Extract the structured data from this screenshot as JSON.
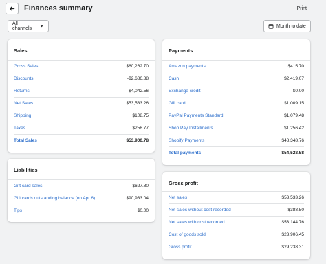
{
  "header": {
    "title": "Finances summary",
    "print_label": "Print"
  },
  "filters": {
    "channels_label": "All channels",
    "date_label": "Month to date"
  },
  "sales": {
    "title": "Sales",
    "rows": [
      {
        "label": "Gross Sales",
        "value": "$60,262.70"
      },
      {
        "label": "Discounts",
        "value": "-$2,686.88"
      },
      {
        "label": "Returns",
        "value": "-$4,042.56"
      },
      {
        "label": "Net Sales",
        "value": "$53,533.26"
      },
      {
        "label": "Shipping",
        "value": "$108.75"
      },
      {
        "label": "Taxes",
        "value": "$258.77"
      },
      {
        "label": "Total Sales",
        "value": "$53,900.78"
      }
    ]
  },
  "liabilities": {
    "title": "Liabilities",
    "rows": [
      {
        "label": "Gift card sales",
        "value": "$627.80"
      },
      {
        "label": "Gift cards outstanding balance (on Apr 6)",
        "value": "$90,933.04"
      },
      {
        "label": "Tips",
        "value": "$0.00"
      }
    ]
  },
  "payments": {
    "title": "Payments",
    "rows": [
      {
        "label": "Amazon payments",
        "value": "$415.70"
      },
      {
        "label": "Cash",
        "value": "$2,419.07"
      },
      {
        "label": "Exchange credit",
        "value": "$0.00"
      },
      {
        "label": "Gift card",
        "value": "$1,009.15"
      },
      {
        "label": "PayPal Payments Standard",
        "value": "$1,079.48"
      },
      {
        "label": "Shop Pay Installments",
        "value": "$1,256.42"
      },
      {
        "label": "Shopify Payments",
        "value": "$48,348.76"
      },
      {
        "label": "Total payments",
        "value": "$54,528.58"
      }
    ]
  },
  "gross_profit": {
    "title": "Gross profit",
    "rows": [
      {
        "label": "Net sales",
        "value": "$53,533.26"
      },
      {
        "label": "Net sales without cost recorded",
        "value": "$388.50"
      },
      {
        "label": "Net sales with cost recorded",
        "value": "$53,144.76"
      },
      {
        "label": "Cost of goods sold",
        "value": "$23,906.45"
      },
      {
        "label": "Gross profit",
        "value": "$29,238.31"
      }
    ]
  },
  "icons": {
    "back": "arrow-left-icon",
    "channels_dropdown": "caret-down-icon",
    "date": "calendar-icon"
  }
}
